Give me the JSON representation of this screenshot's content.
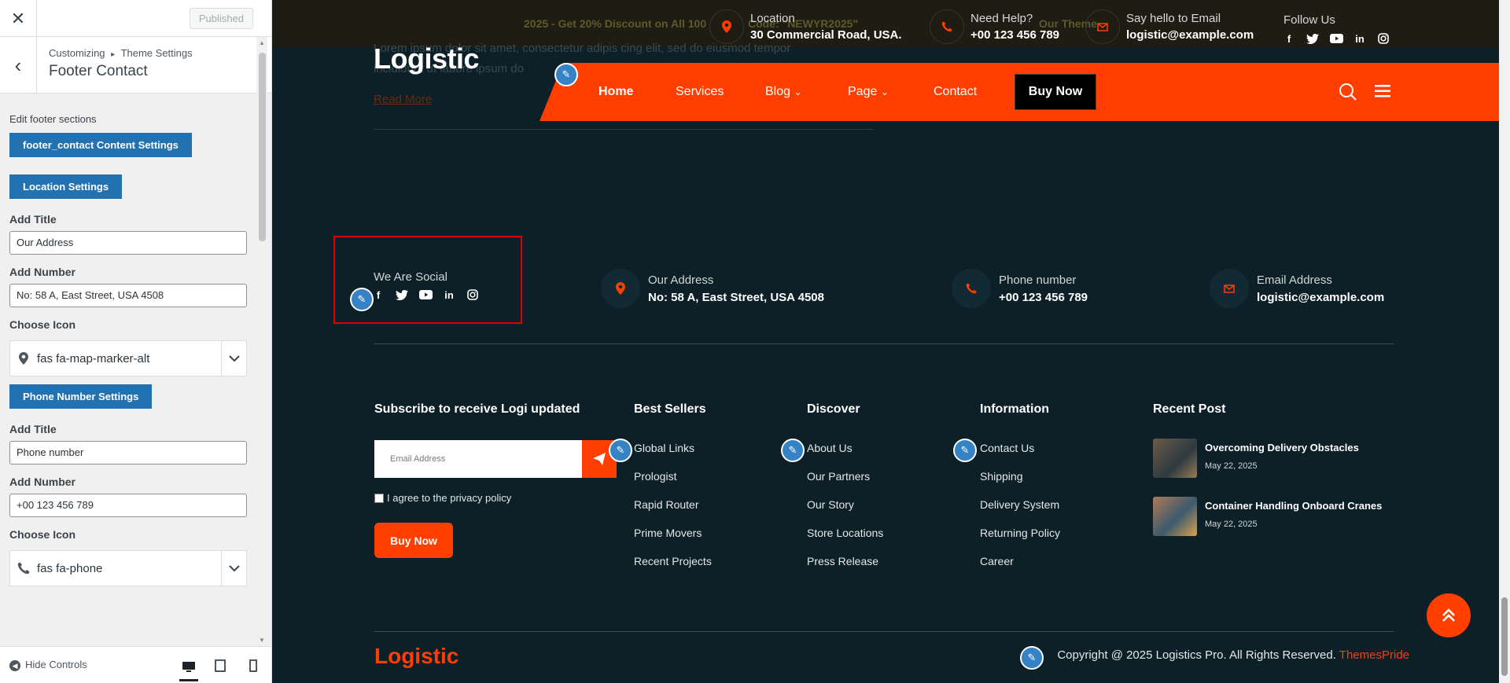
{
  "customizer": {
    "close_icon": "close-icon",
    "published_label": "Published",
    "breadcrumb_root": "Customizing",
    "breadcrumb_sep": "▸",
    "breadcrumb_section": "Theme Settings",
    "panel_title": "Footer Contact",
    "description": "Edit footer sections",
    "btn_content_settings": "footer_contact Content Settings",
    "btn_location_settings": "Location Settings",
    "location": {
      "title_label": "Add Title",
      "title_value": "Our Address",
      "number_label": "Add Number",
      "number_value": "No: 58 A, East Street, USA 4508",
      "icon_label": "Choose Icon",
      "icon_value": "fas fa-map-marker-alt"
    },
    "btn_phone_settings": "Phone Number Settings",
    "phone": {
      "title_label": "Add Title",
      "title_value": "Phone number",
      "number_label": "Add Number",
      "number_value": "+00 123 456 789",
      "icon_label": "Choose Icon",
      "icon_value": "fas fa-phone"
    },
    "hide_controls": "Hide Controls"
  },
  "topbar": {
    "ghost_promo_a": "2025 - Get 20% Discount on All 100",
    "ghost_promo_b": "Code: ",
    "ghost_code": "\"NEWYR2025\"",
    "ghost_buy": "Our Theme",
    "location_title": "Location",
    "location_value": "30 Commercial Road, USA.",
    "help_title": "Need Help?",
    "help_value": "+00 123 456 789",
    "email_title": "Say hello to Email",
    "email_value": "logistic@example.com",
    "follow_title": "Follow Us"
  },
  "nav": {
    "logo": "Logistic",
    "ghost_lorem_1": "Lorem ipsum dolor sit amet, consectetur adipis cing elit, sed do eiusmod tempor",
    "ghost_lorem_2": "incididunt ut labore ipsum do",
    "ghost_read_more": "Read More",
    "items": [
      "Home",
      "Services",
      "Blog",
      "Page",
      "Contact"
    ],
    "buy_now": "Buy Now"
  },
  "contact": {
    "social_title": "We Are Social",
    "address_title": "Our Address",
    "address_value": "No: 58 A, East Street, USA 4508",
    "phone_title": "Phone number",
    "phone_value": "+00 123 456 789",
    "email_title": "Email Address",
    "email_value": "logistic@example.com"
  },
  "footer": {
    "subscribe_title": "Subscribe to receive Logi updated",
    "email_placeholder": "Email Address",
    "agree_text": "I agree to the privacy policy",
    "buy_now": "Buy Now",
    "columns": [
      {
        "title": "Best Sellers",
        "links": [
          "Global Links",
          "Prologist",
          "Rapid Router",
          "Prime Movers",
          "Recent Projects"
        ]
      },
      {
        "title": "Discover",
        "links": [
          "About Us",
          "Our Partners",
          "Our Story",
          "Store Locations",
          "Press Release"
        ]
      },
      {
        "title": "Information",
        "links": [
          "Contact Us",
          "Shipping",
          "Delivery System",
          "Returning Policy",
          "Career"
        ]
      }
    ],
    "recent_title": "Recent Post",
    "posts": [
      {
        "title": "Overcoming Delivery Obstacles",
        "date": "May 22, 2025"
      },
      {
        "title": "Container Handling Onboard Cranes",
        "date": "May 22, 2025"
      }
    ],
    "logo": "Logistic",
    "copyright": "Copyright @ 2025 Logistics Pro. All Rights Reserved. ",
    "credit": "ThemesPride"
  },
  "colors": {
    "accent": "#ff3e00",
    "dark": "#0d1f27",
    "wp_blue": "#2271b1"
  }
}
